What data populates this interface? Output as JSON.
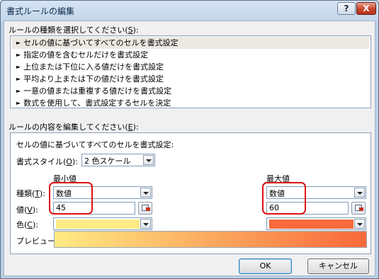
{
  "window": {
    "title": "書式ルールの編集",
    "help_label": "?",
    "close_label": "X"
  },
  "rule_type": {
    "label_text": "ルールの種類を選択してください(",
    "label_key": "S",
    "label_end": "):",
    "items": [
      {
        "label": "セルの値に基づいてすべてのセルを書式設定",
        "selected": true
      },
      {
        "label": "指定の値を含むセルだけを書式設定",
        "selected": false
      },
      {
        "label": "上位または下位に入る値だけを書式設定",
        "selected": false
      },
      {
        "label": "平均より上または下の値だけを書式設定",
        "selected": false
      },
      {
        "label": "一意の値または重複する値だけを書式設定",
        "selected": false
      },
      {
        "label": "数式を使用して、書式設定するセルを決定",
        "selected": false
      }
    ]
  },
  "rule_content": {
    "label_text": "ルールの内容を編集してください(",
    "label_key": "E",
    "label_end": "):",
    "description": "セルの値に基づいてすべてのセルを書式設定:",
    "format_style_label": "書式スタイル(",
    "format_style_key": "O",
    "format_style_end": "):",
    "format_style_value": "2 色スケール",
    "min_header": "最小値",
    "max_header": "最大値",
    "type_label": "種類(",
    "type_key": "T",
    "type_end": "):",
    "value_label": "値(",
    "value_key": "V",
    "value_end": "):",
    "color_label": "色(",
    "color_key": "C",
    "color_end": "):",
    "min_type": "数値",
    "max_type": "数値",
    "min_value": "45",
    "max_value": "60",
    "min_color": "#ffeb84",
    "max_color": "#f8693b",
    "preview_label": "プレビュー:"
  },
  "buttons": {
    "ok": "OK",
    "cancel": "キャンセル"
  }
}
